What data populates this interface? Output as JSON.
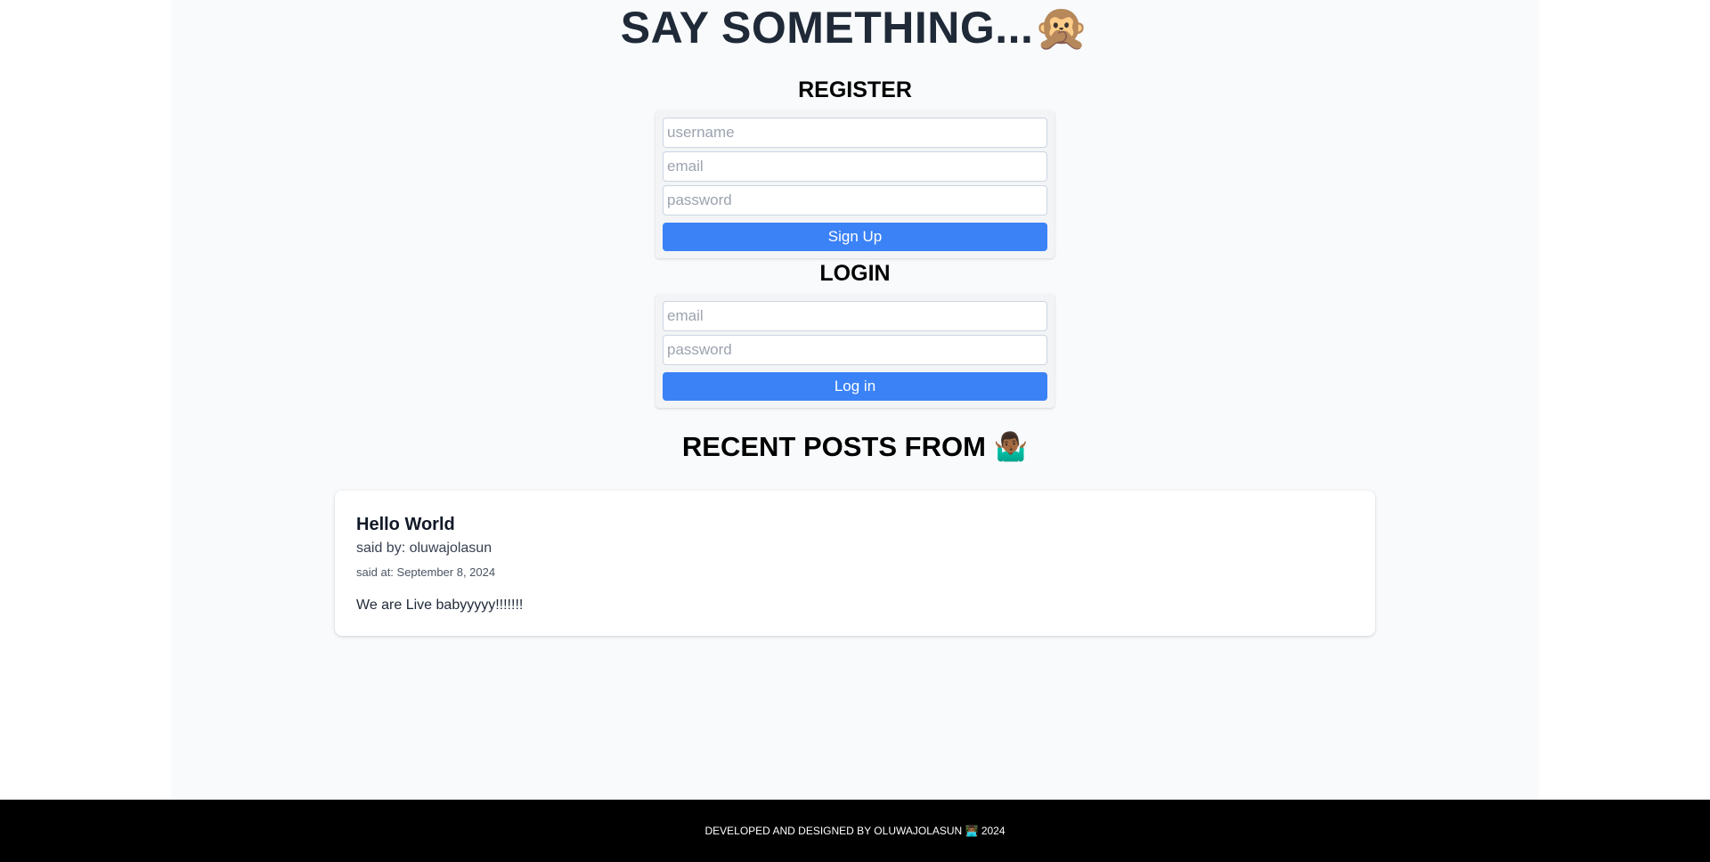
{
  "header": {
    "title": "SAY SOMETHING...🙊"
  },
  "register": {
    "heading": "REGISTER",
    "username_placeholder": "username",
    "email_placeholder": "email",
    "password_placeholder": "password",
    "submit_label": "Sign Up"
  },
  "login": {
    "heading": "LOGIN",
    "email_placeholder": "email",
    "password_placeholder": "password",
    "submit_label": "Log in"
  },
  "posts": {
    "heading": "RECENT POSTS FROM 🤷🏾‍♂️",
    "items": [
      {
        "title": "Hello World",
        "author": "said by: oluwajolasun",
        "date": "said at: September 8, 2024",
        "body": "We are Live babyyyyy!!!!!!!"
      }
    ]
  },
  "footer": {
    "text": "DEVELOPED AND DESIGNED BY OLUWAJOLASUN 👨🏾‍💻 2024"
  },
  "colors": {
    "accent": "#3b82f6",
    "page_background": "#f8fafc",
    "footer_background": "#000000",
    "title_text": "#1f2937"
  }
}
